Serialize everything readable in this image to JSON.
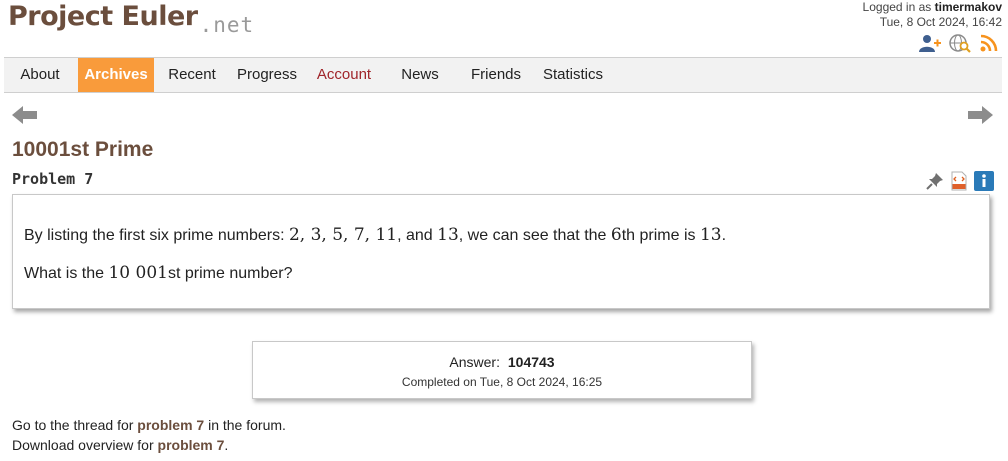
{
  "header": {
    "logo_main": "Project Euler",
    "logo_suffix": ".net",
    "login_prefix": "Logged in as",
    "username": "timermakov",
    "datetime": "Tue, 8 Oct 2024, 16:42",
    "icons": [
      "user-add-icon",
      "globe-search-icon",
      "rss-icon"
    ]
  },
  "nav": {
    "items": [
      {
        "label": "About"
      },
      {
        "label": "Archives"
      },
      {
        "label": "Recent"
      },
      {
        "label": "Progress"
      },
      {
        "label": "Account"
      },
      {
        "label": "News"
      },
      {
        "label": "Friends"
      },
      {
        "label": "Statistics"
      }
    ],
    "active": "Archives"
  },
  "problem": {
    "title": "10001st Prime",
    "number_label": "Problem 7",
    "line1": {
      "pre": "By listing the first six prime numbers: ",
      "primes": "2, 3, 5, 7, 11",
      "and": ", and ",
      "last": "13",
      "mid": ", we can see that the ",
      "six": "6",
      "th": "th prime is ",
      "ans": "13",
      "end": "."
    },
    "line2": {
      "pre": "What is the ",
      "num": "10 001",
      "post": "st prime number?"
    },
    "icons": [
      "pin-icon",
      "html-file-icon",
      "info-icon"
    ]
  },
  "answer": {
    "label": "Answer:",
    "value": "104743",
    "completed": "Completed on Tue, 8 Oct 2024, 16:25"
  },
  "footer": {
    "thread_pre": "Go to the thread for ",
    "thread_link": "problem 7",
    "thread_post": " in the forum.",
    "download_pre": "Download overview for ",
    "download_link": "problem 7",
    "download_post": "."
  },
  "colors": {
    "brand_brown": "#6b4e3d",
    "active_tab": "#f99b3b",
    "account_red": "#a0252a",
    "rss_orange": "#f7931e",
    "info_blue": "#2a7ab8"
  }
}
